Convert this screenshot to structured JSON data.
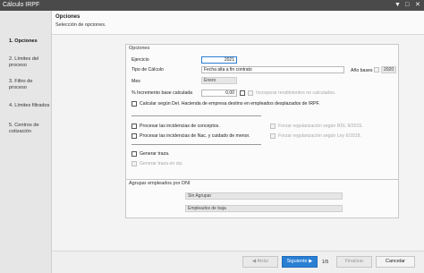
{
  "window": {
    "title": "Cálculo IRPF",
    "controls": [
      "▼",
      "□",
      "✕"
    ]
  },
  "sidebar": {
    "steps": [
      {
        "label": "1. Opciones"
      },
      {
        "label": "2. Límites del\nproceso"
      },
      {
        "label": "3. Filtro de\nproceso"
      },
      {
        "label": "4. Límites filtrados"
      },
      {
        "label": "5. Centros de\ncotización"
      }
    ]
  },
  "header": {
    "title": "Opciones",
    "subtitle": "Selección de opciones."
  },
  "options": {
    "group_title": "Opciones",
    "ejercicio_label": "Ejercicio",
    "ejercicio_value": "2021",
    "tipo_label": "Tipo de Cálculo",
    "tipo_value": "Fecha alta a fin contrato",
    "anio_bases_label": "Año bases",
    "anio_bases_value": "2020",
    "mes_label": "Mes",
    "mes_value": "Enero",
    "incremento_label": "% Incremento base calculada",
    "incremento_value": "0,00",
    "incorporar_label": "Incorporar rendimientos no calculados.",
    "calcular_label": "Calcular según Del. Hacienda de empresa destino en empleados desplazados de IRPF.",
    "procesar_conceptos_label": "Procesar las incidencias de conceptos.",
    "forzar_rdl_label": "Forzar regularización según RDL 9/2015.",
    "procesar_nac_label": "Procesar las incidencias de Nac. y cuidado de menor.",
    "forzar_ley_label": "Forzar regularización según Ley 6/2018.",
    "generar_traza_label": "Generar traza.",
    "generar_zip_label": "Generar traza en zip."
  },
  "agrupar": {
    "group_title": "Agrupar empleados por DNI",
    "sin_agrupar": "Sin Agrupar",
    "empleados_baja": "Empleados de baja"
  },
  "footer": {
    "atras": "Atrás",
    "siguiente": "Siguiente",
    "page": "1/5",
    "finalizar": "Finalizar",
    "cancelar": "Cancelar"
  },
  "colors": {
    "accent": "#2a7fd4",
    "titlebar": "#4a4a4a"
  }
}
